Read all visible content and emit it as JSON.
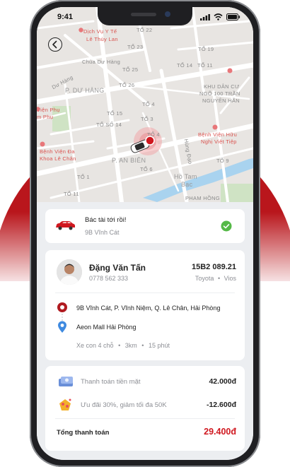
{
  "status_bar": {
    "time": "9:41"
  },
  "map": {
    "labels": [
      {
        "text": "Dịch Vụ Y Tế",
        "cls": "red"
      },
      {
        "text": "Lê Thùy Lan",
        "cls": "red"
      },
      {
        "text": "TỔ 22"
      },
      {
        "text": "TỔ 23"
      },
      {
        "text": "TỔ 19"
      },
      {
        "text": "Chùa Dư Hàng"
      },
      {
        "text": "TỔ 25"
      },
      {
        "text": "TỔ 14"
      },
      {
        "text": "TỔ 11"
      },
      {
        "text": "Dư Hàng"
      },
      {
        "text": "TỔ 26"
      },
      {
        "text": "KHU DÂN CƯ"
      },
      {
        "text": "NGÕ 100 TRẦN"
      },
      {
        "text": "NGUYÊN HÃN"
      },
      {
        "text": "P. DƯ HÀNG",
        "cls": "big"
      },
      {
        "text": "Viện Phụ",
        "cls": "red"
      },
      {
        "text": "m Phụ",
        "cls": "red"
      },
      {
        "text": "TỔ 15"
      },
      {
        "text": "TỔ 4"
      },
      {
        "text": "TỔ SỐ 14"
      },
      {
        "text": "TỔ 3"
      },
      {
        "text": "Bệnh Viện Hữu",
        "cls": "red"
      },
      {
        "text": "Nghị Việt Tiệp",
        "cls": "red"
      },
      {
        "text": "TỔ 4"
      },
      {
        "text": "Bệnh Viện Đa",
        "cls": "red"
      },
      {
        "text": "Khoa Lê Chân",
        "cls": "red"
      },
      {
        "text": "P. AN BIÊN",
        "cls": "big"
      },
      {
        "text": "TỔ 6"
      },
      {
        "text": "TỔ 9"
      },
      {
        "text": "TỔ 1"
      },
      {
        "text": "Hồ Tam",
        "cls": "big"
      },
      {
        "text": "Bạc",
        "cls": "big"
      },
      {
        "text": "TỔ 11"
      },
      {
        "text": "PHAM HỒNG"
      },
      {
        "text": "Hùng Đạo"
      }
    ]
  },
  "arrival": {
    "title": "Bác tài tới rồi!",
    "address": "9B Vĩnh Cát"
  },
  "driver": {
    "name": "Đặng Văn Tấn",
    "phone": "0778 562 333",
    "plate": "15B2 089.21",
    "car_brand": "Toyota",
    "car_model": "Vios"
  },
  "route": {
    "pickup": "9B Vĩnh Cát, P. Vĩnh Niệm, Q. Lê Chân, Hải Phòng",
    "dropoff": "Aeon Mall Hải Phòng",
    "vehicle": "Xe con 4 chỗ",
    "distance": "3km",
    "duration": "15 phút"
  },
  "payment": {
    "method_label": "Thanh toán tiền mặt",
    "method_amount": "42.000đ",
    "promo_label": "Ưu đãi 30%, giảm tối đa 50K",
    "promo_amount": "-12.600đ",
    "total_label": "Tổng thanh toán",
    "total_amount": "29.400đ"
  },
  "colors": {
    "accent": "#d0171f",
    "success": "#55b947",
    "dropoff": "#3f8ae0",
    "bg_circle": "#b9161c"
  }
}
